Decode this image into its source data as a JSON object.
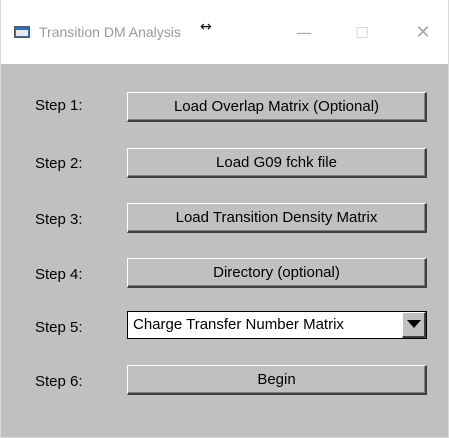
{
  "window": {
    "title": "Transition DM Analysis",
    "cursor_glyph": "↔",
    "minimize_glyph": "—",
    "maximize_glyph": "☐",
    "close_glyph": "✕"
  },
  "steps": [
    {
      "label": "Step 1:",
      "action": "Load Overlap Matrix (Optional)"
    },
    {
      "label": "Step 2:",
      "action": "Load G09 fchk file"
    },
    {
      "label": "Step 3:",
      "action": "Load Transition Density Matrix"
    },
    {
      "label": "Step 4:",
      "action": "Directory (optional)"
    },
    {
      "label": "Step 5:",
      "action": "Charge Transfer Number Matrix"
    },
    {
      "label": "Step 6:",
      "action": "Begin"
    }
  ],
  "colors": {
    "window_bg": "#c0c0c0",
    "titlebar_bg": "#ffffff",
    "title_text": "#9a9a9a"
  }
}
